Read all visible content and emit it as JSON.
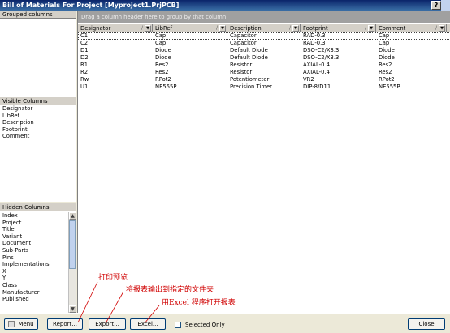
{
  "window": {
    "title": "Bill of Materials For Project [Myproject1.PrjPCB]"
  },
  "grouped_panel": {
    "header": "Grouped columns"
  },
  "visible_panel": {
    "header": "Visible Columns",
    "items": [
      "Designator",
      "LibRef",
      "Description",
      "Footprint",
      "Comment"
    ]
  },
  "hidden_panel": {
    "header": "Hidden Columns",
    "items": [
      "Index",
      "Project",
      "Title",
      "Variant",
      "Document",
      "Sub-Parts",
      "Pins",
      "Implementations",
      "X",
      "Y",
      "Class",
      "Manufacturer",
      "Published"
    ]
  },
  "grid": {
    "group_hint": "Drag a column header here to group by that column",
    "columns": [
      "Designator",
      "LibRef",
      "Description",
      "Footprint",
      "Comment"
    ],
    "rows": [
      [
        "C1",
        "Cap",
        "Capacitor",
        "RAD-0.3",
        "Cap"
      ],
      [
        "C2",
        "Cap",
        "Capacitor",
        "RAD-0.3",
        "Cap"
      ],
      [
        "D1",
        "Diode",
        "Default Diode",
        "DSO-C2/X3.3",
        "Diode"
      ],
      [
        "D2",
        "Diode",
        "Default Diode",
        "DSO-C2/X3.3",
        "Diode"
      ],
      [
        "R1",
        "Res2",
        "Resistor",
        "AXIAL-0.4",
        "Res2"
      ],
      [
        "R2",
        "Res2",
        "Resistor",
        "AXIAL-0.4",
        "Res2"
      ],
      [
        "Rw",
        "RPot2",
        "Potentiometer",
        "VR2",
        "RPot2"
      ],
      [
        "U1",
        "NE555P",
        "Precision Timer",
        "DIP-8/D11",
        "NE555P"
      ]
    ]
  },
  "bottom": {
    "menu_label": "Menu",
    "report_label": "Report...",
    "export_label": "Export...",
    "excel_label": "Excel...",
    "selected_only_label": "Selected Only",
    "close_label": "Close"
  },
  "annotations": {
    "print_preview": "打印预览",
    "export_to_file": "将报表输出到指定的文件夹",
    "open_with_excel": "用Excel 程序打开报表"
  },
  "colors": {
    "annotation": "#d00000",
    "title_bar": "#0a246a"
  }
}
